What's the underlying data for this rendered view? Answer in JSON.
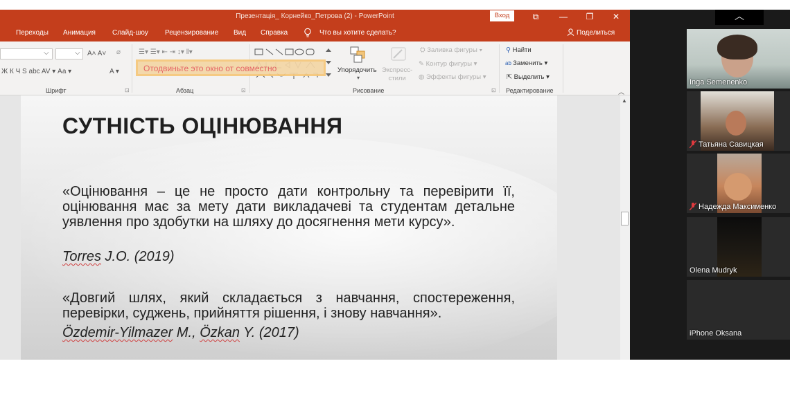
{
  "window": {
    "title": "Презентація_ Корнейко_Петрова (2)  -  PowerPoint",
    "login_label": "Вход",
    "controls": [
      "⧉",
      "—",
      "❐",
      "✕"
    ]
  },
  "tabs": [
    "Переходы",
    "Анимация",
    "Слайд-шоу",
    "Рецензирование",
    "Вид",
    "Справка"
  ],
  "tell_me": "Что вы хотите сделать?",
  "share": "Поделиться",
  "ribbon": {
    "groups": {
      "font": "Шрифт",
      "paragraph": "Абзац",
      "drawing": "Рисование",
      "editing": "Редактирование"
    },
    "font_row2": "Ж  К  Ч  S  abc  AV ▾  Аа ▾",
    "font_row1_sizes": "A˄  A˅",
    "arrange": "Упорядочить",
    "express_styles": "Экспресс-\nстили",
    "shape_fill": "Заливка фигуры",
    "shape_outline": "Контур фигуры",
    "shape_effects": "Эффекты фигуры",
    "find": "Найти",
    "replace": "Заменить",
    "select": "Выделить"
  },
  "share_overlay": "Отодвиньте это окно от совместно",
  "slide": {
    "title": "СУТНІСТЬ ОЦІНЮВАННЯ",
    "quote1": "«Оцінювання – це не просто дати контрольну та перевірити її, оцінювання має за мету дати викладачеві та студентам детальне уявлення про здобутки на шляху до досягнення мети курсу».",
    "cite1_author": "Torres",
    "cite1_rest": " J.O. (2019)",
    "quote2": "«Довгий шлях, який складається з навчання, спостереження, перевірки, суджень, прийняття рішення, і знову навчання».",
    "cite2_a": "Özdemir-Yilmazer",
    "cite2_b": " M., ",
    "cite2_c": "Özkan",
    "cite2_d": " Y.  (2017)"
  },
  "zoom": {
    "collapse": "︿",
    "participants": [
      {
        "name": "Inga Semenenko",
        "muted": false
      },
      {
        "name": "Татьяна Савицкая",
        "muted": true
      },
      {
        "name": "Надежда Максименко",
        "muted": true
      },
      {
        "name": "Olena Mudryk",
        "muted": false
      },
      {
        "name": "iPhone Oksana",
        "muted": false
      }
    ]
  },
  "colors": {
    "ppt_accent": "#c43e1c",
    "ribbon_bg": "#f3f2f1",
    "zoom_bg": "#1a1a1a",
    "muted_mic": "#e0393e"
  }
}
